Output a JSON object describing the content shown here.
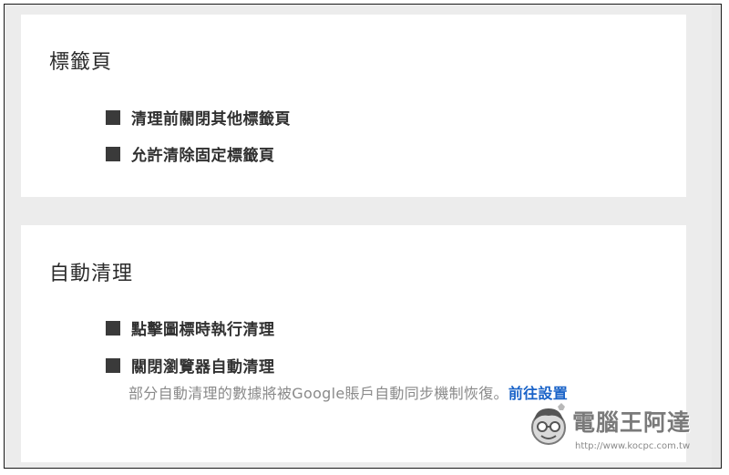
{
  "sections": {
    "tabs": {
      "title": "標籤頁",
      "options": [
        {
          "label": "清理前關閉其他標籤頁",
          "checked": true
        },
        {
          "label": "允許清除固定標籤頁",
          "checked": true
        }
      ]
    },
    "auto_clean": {
      "title": "自動清理",
      "options": [
        {
          "label": "點擊圖標時執行清理",
          "checked": true
        },
        {
          "label": "關閉瀏覽器自動清理",
          "checked": true
        }
      ],
      "notice_text": "部分自動清理的數據將被Google賬戶自動同步機制恢復。",
      "notice_link": "前往設置"
    }
  },
  "watermark": {
    "title": "電腦王阿達",
    "url": "http://www.kocpc.com.tw"
  },
  "colors": {
    "checkbox": "#3a3a3a",
    "link": "#1a63c8",
    "background": "#ececec",
    "card": "#ffffff"
  }
}
